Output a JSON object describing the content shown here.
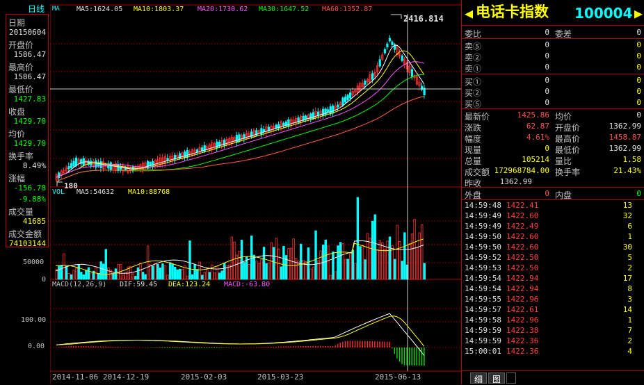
{
  "chart_header": {
    "period": "日线",
    "ma_label": "MA",
    "ma5": "MA5:1624.05",
    "ma10": "MA10:1803.37",
    "ma20": "MA20:1730.62",
    "ma30": "MA30:1647.52",
    "ma60": "MA60:1352.87",
    "high_marker": "2416.814",
    "low_marker": "180"
  },
  "left_info": {
    "date_label": "日期",
    "date": "20150604",
    "open_label": "开盘价",
    "open": "1586.47",
    "high_label": "最高价",
    "high": "1586.47",
    "low_label": "最低价",
    "low": "1427.83",
    "close_label": "收盘",
    "close": "1429.70",
    "avg_label": "均价",
    "avg": "1429.70",
    "turnover_label": "换手率",
    "turnover": "8.49%",
    "change_label": "涨幅",
    "change": "-156.78",
    "change_pct": "-9.88%",
    "volume_label": "成交量",
    "volume": "41685",
    "amount_label": "成交金额",
    "amount": "74103144"
  },
  "volume_panel": {
    "vol": "VOL",
    "ma5": "MA5:54632",
    "ma10": "MA10:88768",
    "tick_50000": "50000",
    "tick_0": "0"
  },
  "macd_panel": {
    "title": "MACD(12,26,9)",
    "dif": "DIF:59.45",
    "dea": "DEA:123.24",
    "macd": "MACD:-63.80",
    "tick_100": "100.00",
    "tick_0": "0.00"
  },
  "x_axis": [
    "2014-11-06",
    "2014-12-19",
    "2015-02-03",
    "2015-03-23",
    "2015-06-13"
  ],
  "quote": {
    "name": "电话卡指数",
    "code": "100004",
    "webi_label": "委比",
    "webi": "0",
    "weicha_label": "委差",
    "weicha": "0",
    "sell": [
      {
        "label": "卖⑤",
        "price": "0",
        "vol": "0"
      },
      {
        "label": "卖②",
        "price": "0",
        "vol": "0"
      },
      {
        "label": "卖①",
        "price": "0",
        "vol": "0"
      }
    ],
    "buy": [
      {
        "label": "买①",
        "price": "0",
        "vol": "0"
      },
      {
        "label": "买②",
        "price": "0",
        "vol": "0"
      },
      {
        "label": "买⑤",
        "price": "0",
        "vol": "0"
      }
    ],
    "latest_label": "最新价",
    "latest": "1425.86",
    "avgp_label": "均价",
    "avgp": "0",
    "chg_label": "涨跌",
    "chg": "62.87",
    "open_label": "开盘价",
    "open": "1362.99",
    "amp_label": "幅度",
    "amp": "4.61%",
    "high_label": "最高价",
    "high": "1458.87",
    "cur_label": "现量",
    "cur": "0",
    "low_label": "最低价",
    "low": "1362.99",
    "total_label": "总量",
    "total": "105214",
    "volratio_label": "量比",
    "volratio": "1.58",
    "amount_label": "成交额",
    "amount": "172968784.00",
    "turnover_label": "换手率",
    "turnover": "21.43%",
    "prev_label": "昨收",
    "prev": "1362.99",
    "outer_label": "外盘",
    "outer": "0",
    "inner_label": "内盘",
    "inner": "0"
  },
  "ticks": [
    {
      "t": "14:59:48",
      "p": "1422.41",
      "v": "13"
    },
    {
      "t": "14:59:49",
      "p": "1422.60",
      "v": "32"
    },
    {
      "t": "14:59:49",
      "p": "1422.49",
      "v": "6"
    },
    {
      "t": "14:59:50",
      "p": "1422.60",
      "v": "1"
    },
    {
      "t": "14:59:50",
      "p": "1422.60",
      "v": "30"
    },
    {
      "t": "14:59:52",
      "p": "1422.50",
      "v": "5"
    },
    {
      "t": "14:59:53",
      "p": "1422.50",
      "v": "2"
    },
    {
      "t": "14:59:54",
      "p": "1422.94",
      "v": "17"
    },
    {
      "t": "14:59:54",
      "p": "1422.94",
      "v": "8"
    },
    {
      "t": "14:59:55",
      "p": "1422.96",
      "v": "3"
    },
    {
      "t": "14:59:57",
      "p": "1422.61",
      "v": "14"
    },
    {
      "t": "14:59:58",
      "p": "1422.96",
      "v": "1"
    },
    {
      "t": "14:59:59",
      "p": "1422.38",
      "v": "7"
    },
    {
      "t": "14:59:59",
      "p": "1422.36",
      "v": "2"
    },
    {
      "t": "15:00:01",
      "p": "1422.36",
      "v": "4"
    }
  ],
  "bottom_tabs": [
    "细",
    "图"
  ],
  "colors": {
    "up": "#ff3030",
    "down": "#00ffff",
    "macd_up": "#ff3030",
    "macd_down": "#00e000"
  }
}
